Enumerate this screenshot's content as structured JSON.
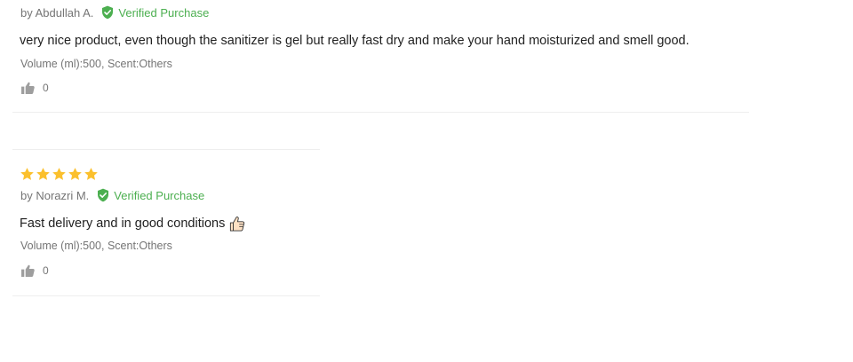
{
  "reviews": [
    {
      "author": "by Abdullah A.",
      "verified_label": "Verified Purchase",
      "content": "very nice product, even though the sanitizer is gel but really fast dry and make your hand moisturized and smell good.",
      "sku": "Volume (ml):500, Scent:Others",
      "likes": "0"
    },
    {
      "rating": 5,
      "author": "by Norazri M.",
      "verified_label": "Verified Purchase",
      "content": "Fast delivery and in good conditions",
      "sku": "Volume (ml):500, Scent:Others",
      "likes": "0"
    }
  ],
  "colors": {
    "star": "#fbc02d",
    "verified": "#4caf50",
    "secondary_text": "#757575",
    "divider": "#eeeeee"
  },
  "icons": {
    "verified": "shield-check-icon",
    "like": "thumbs-up-icon",
    "content_emoji": "thumbs-up-emoji"
  }
}
